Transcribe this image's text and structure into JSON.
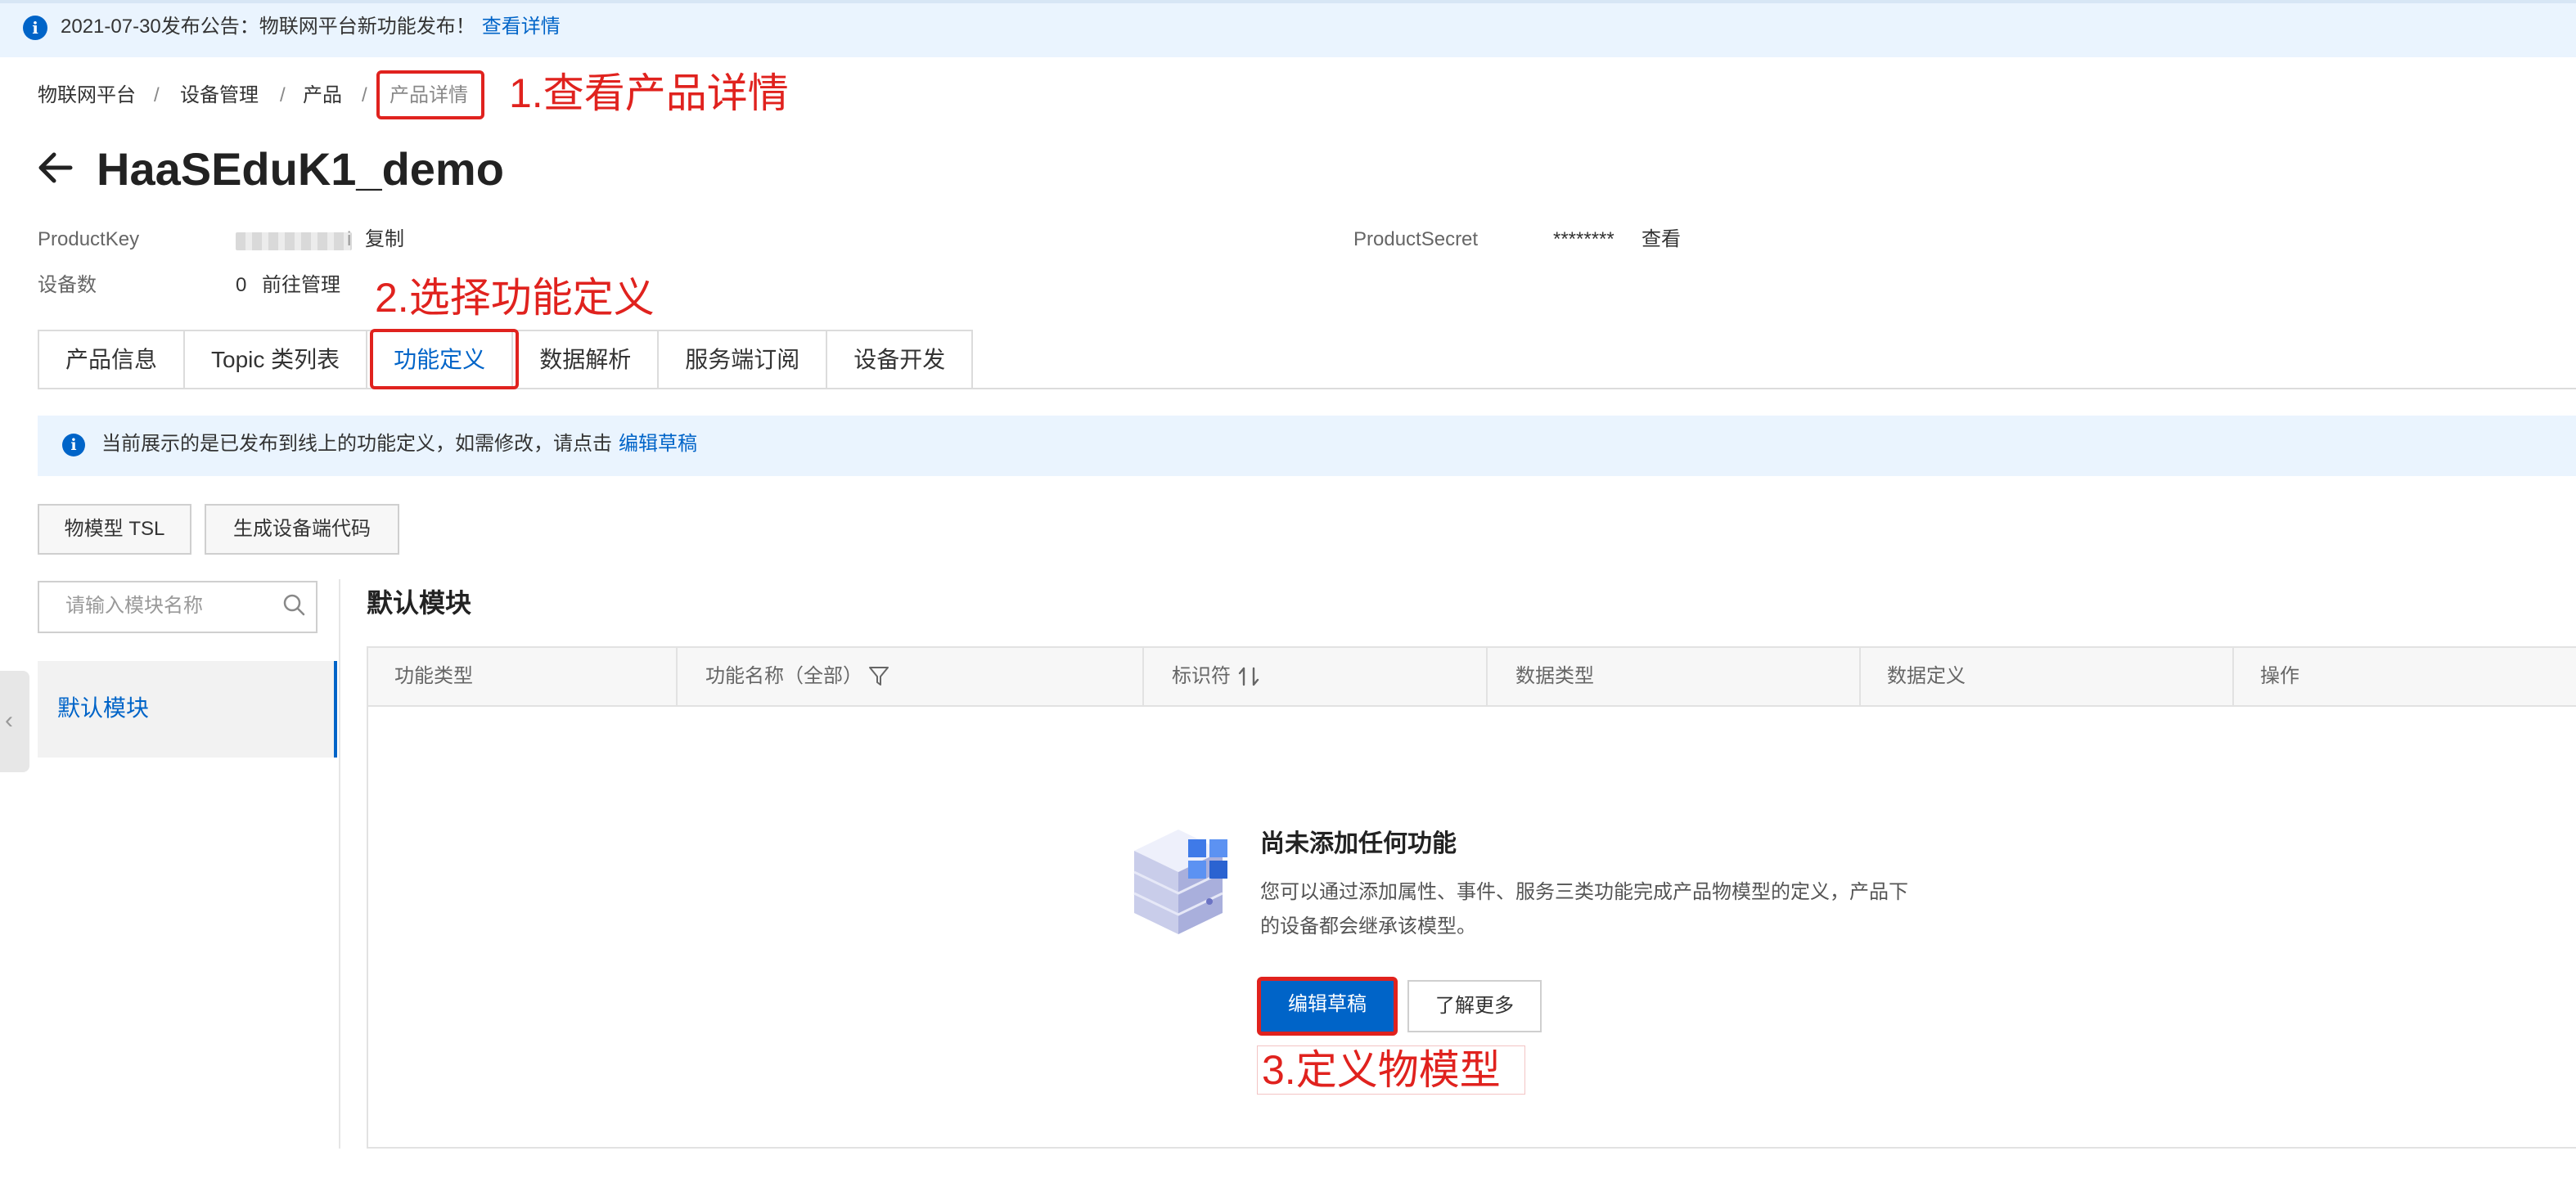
{
  "announcement": {
    "text": "2021-07-30发布公告：物联网平台新功能发布！",
    "link": "查看详情"
  },
  "breadcrumb": {
    "items": [
      "物联网平台",
      "设备管理",
      "产品",
      "产品详情"
    ],
    "separator": "/"
  },
  "annotations": {
    "step1": "1.查看产品详情",
    "step2": "2.选择功能定义",
    "step3": "3.定义物模型",
    "color": "#e0221e"
  },
  "page": {
    "title": "HaaSEduK1_demo"
  },
  "meta": {
    "product_key_label": "ProductKey",
    "product_key_suffix": "i",
    "copy_link": "复制",
    "device_count_label": "设备数",
    "device_count": "0",
    "manage_link": "前往管理",
    "product_secret_label": "ProductSecret",
    "product_secret_value": "********",
    "view_link": "查看"
  },
  "tabs": [
    "产品信息",
    "Topic 类列表",
    "功能定义",
    "数据解析",
    "服务端订阅",
    "设备开发"
  ],
  "active_tab": "功能定义",
  "notice": {
    "text": "当前展示的是已发布到线上的功能定义，如需修改，请点击",
    "link": "编辑草稿"
  },
  "toolbar": {
    "tsl_button": "物模型 TSL",
    "codegen_button": "生成设备端代码"
  },
  "modules": {
    "search_placeholder": "请输入模块名称",
    "items": [
      "默认模块"
    ]
  },
  "section": {
    "title": "默认模块"
  },
  "table": {
    "headers": [
      "功能类型",
      "功能名称（全部）",
      "标识符",
      "数据类型",
      "数据定义",
      "操作"
    ]
  },
  "empty": {
    "title": "尚未添加任何功能",
    "desc": "您可以通过添加属性、事件、服务三类功能完成产品物模型的定义，产品下的设备都会继承该模型。",
    "edit_button": "编辑草稿",
    "more_button": "了解更多"
  },
  "colors": {
    "primary": "#0064c8",
    "notice_bg": "#eaf4fe"
  }
}
